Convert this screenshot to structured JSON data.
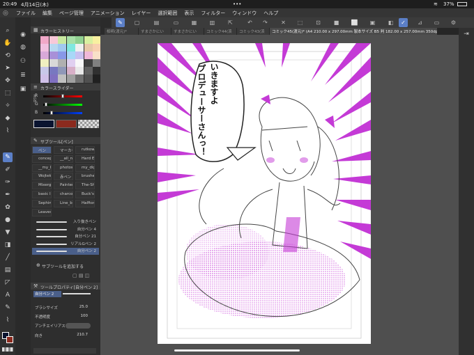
{
  "status": {
    "time": "20:49",
    "date": "4月14日(木)",
    "dots": "•••",
    "battery": "37%"
  },
  "menu": [
    "ファイル",
    "編集",
    "ページ管理",
    "アニメーション",
    "レイヤー",
    "選択範囲",
    "表示",
    "フィルター",
    "ウィンドウ",
    "ヘルプ"
  ],
  "tabs": [
    "相明(渡元)*",
    "すまさかにい",
    "すまさかにい",
    "コミック44(涙",
    "コミック43(涙",
    "コミック45(渡元)* (A4 210.00 x 297.00mm 製本サイズ B5 判 182.00 x 257.00mm 350dpi 42.3%)"
  ],
  "panels": {
    "color_history": "カラーヒストリー",
    "color_slider": "カラースライダー",
    "color_slider_mode": "RGB",
    "rgb_labels": [
      "R",
      "G",
      "B"
    ],
    "subtool_title": "サブツール[ペン]",
    "tool_property_title": "ツールプロパティ[自分ペン 2]",
    "add_subtool": "サブツールを追加する"
  },
  "subtools": [
    [
      "ペン",
      "マーカー",
      "rutkowski"
    ],
    [
      "concept",
      "__all_n",
      "Hard Ed"
    ],
    [
      "__my_b",
      "photosi",
      "my_digit"
    ],
    [
      "Wojtek",
      "赤ペン",
      "brushes"
    ],
    [
      "Mixergo",
      "Painter",
      "The-Sh"
    ],
    [
      "basic I",
      "charcoa",
      "Buck's"
    ],
    [
      "Sephim",
      "Line_b",
      "Halftone"
    ],
    [
      "Leaves",
      "",
      ""
    ]
  ],
  "brushes": [
    "入り抜きペン",
    "自分ペン 4",
    "自分ペン 21",
    "リアルGペン 2",
    "自分ペン 2"
  ],
  "properties": {
    "current_brush": "自分ペン 2",
    "brush_size_label": "ブラシサイズ",
    "brush_size_value": "25.0",
    "opacity_label": "不透明度",
    "opacity_value": "100",
    "antialias_label": "アンチエイリアス",
    "direction_label": "向き",
    "direction_value": "210.7"
  },
  "balloon_lines": [
    "いきますよ",
    "プロデューサーさんっ！"
  ],
  "colors": {
    "accent": "#5b7fc7",
    "magenta": "#c43ad6",
    "main_color": "#0a1430",
    "sub_color": "#8b2a1e"
  },
  "palette": [
    "#f0a8c8",
    "#f8c8d8",
    "#c8e8a0",
    "#a8e0a8",
    "#90d090",
    "#d8f0a0",
    "#f8f0a0",
    "#f0c0e0",
    "#b8d8f0",
    "#a0c8f0",
    "#80e8e0",
    "#f0f0f0",
    "#e8c8a8",
    "#f8d0b0",
    "#d8a8d8",
    "#a890d8",
    "#8898e8",
    "#a8d8f8",
    "#c8c0f0",
    "#f0b8d8",
    "#f8e0c8",
    "#f0f0c0",
    "#d8d8d8",
    "#b0b0b0",
    "#e0d0f0",
    "#f8f8f8",
    "#404040",
    "#808080",
    "#c8c8e8",
    "#7878c0",
    "#9098b8",
    "#d8b0c8",
    "#e8e8e8",
    "#606060",
    "#303030",
    "#d0c0e8",
    "#8070c0",
    "#c0c0c0",
    "#a0a0a0",
    "#707070",
    "#505050",
    "#202020"
  ]
}
